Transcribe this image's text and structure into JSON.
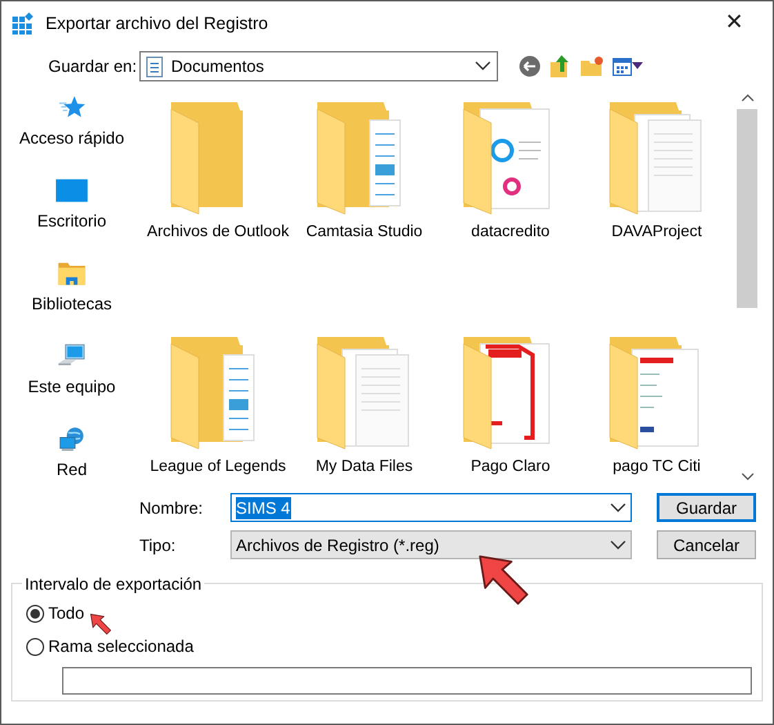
{
  "window": {
    "title": "Exportar archivo del Registro",
    "close": "✕"
  },
  "location": {
    "label": "Guardar en:",
    "value": "Documentos"
  },
  "places": [
    {
      "label": "Acceso rápido",
      "kind": "star"
    },
    {
      "label": "Escritorio",
      "kind": "desktop"
    },
    {
      "label": "Bibliotecas",
      "kind": "library"
    },
    {
      "label": "Este equipo",
      "kind": "computer"
    },
    {
      "label": "Red",
      "kind": "network"
    }
  ],
  "files": [
    {
      "name": "Archivos de Outlook",
      "kind": "empty"
    },
    {
      "name": "Camtasia Studio",
      "kind": "docs"
    },
    {
      "name": "datacredito",
      "kind": "rings"
    },
    {
      "name": "DAVAProject",
      "kind": "pages"
    },
    {
      "name": "League of Legends",
      "kind": "docs"
    },
    {
      "name": "My Data Files",
      "kind": "pages"
    },
    {
      "name": "Pago Claro",
      "kind": "red"
    },
    {
      "name": "pago TC Citi",
      "kind": "form"
    }
  ],
  "filename": {
    "label": "Nombre:",
    "value": "SIMS 4"
  },
  "filetype": {
    "label": "Tipo:",
    "value": "Archivos de Registro (*.reg)"
  },
  "buttons": [
    "Guardar",
    "Cancelar"
  ],
  "range": {
    "title": "Intervalo de exportación",
    "options": [
      {
        "label": "Todo",
        "selected": true
      },
      {
        "label": "Rama seleccionada",
        "selected": false
      }
    ]
  }
}
